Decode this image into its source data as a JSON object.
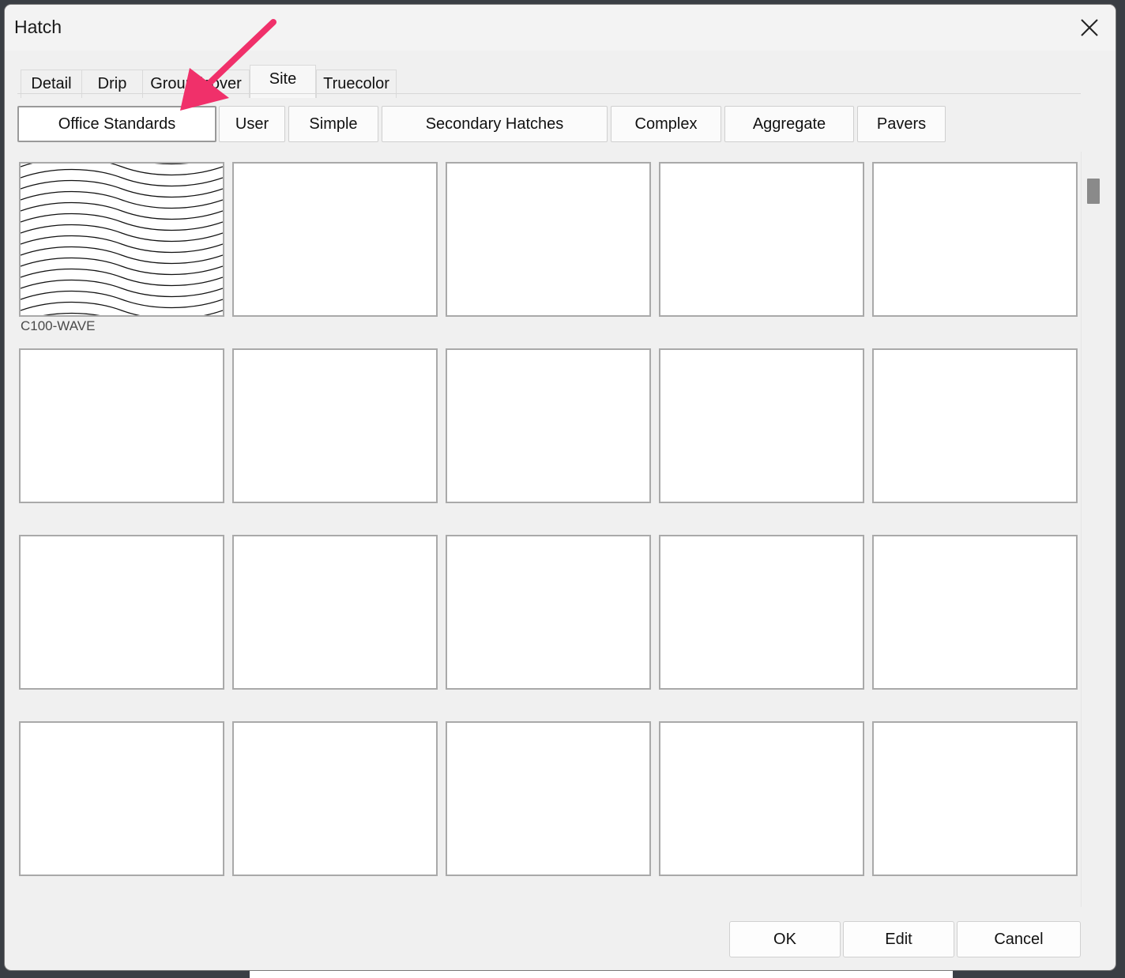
{
  "window": {
    "title": "Hatch"
  },
  "tabs": [
    {
      "label": "Detail"
    },
    {
      "label": "Drip"
    },
    {
      "label": "Groundcover"
    },
    {
      "label": "Site"
    },
    {
      "label": "Truecolor"
    }
  ],
  "active_tab": "Site",
  "categories": [
    {
      "label": "Office Standards"
    },
    {
      "label": "User"
    },
    {
      "label": "Simple"
    },
    {
      "label": "Secondary Hatches"
    },
    {
      "label": "Complex"
    },
    {
      "label": "Aggregate"
    },
    {
      "label": "Pavers"
    }
  ],
  "selected_category": "Office Standards",
  "swatches": [
    {
      "label": "C100-WAVE",
      "pattern": "wave"
    }
  ],
  "empty_swatch_count": 19,
  "actions": {
    "ok": "OK",
    "edit": "Edit",
    "cancel": "Cancel"
  },
  "annotation_color": "#f0306a",
  "icons": {
    "close": "close-icon",
    "arrow": "annotation-arrow"
  }
}
